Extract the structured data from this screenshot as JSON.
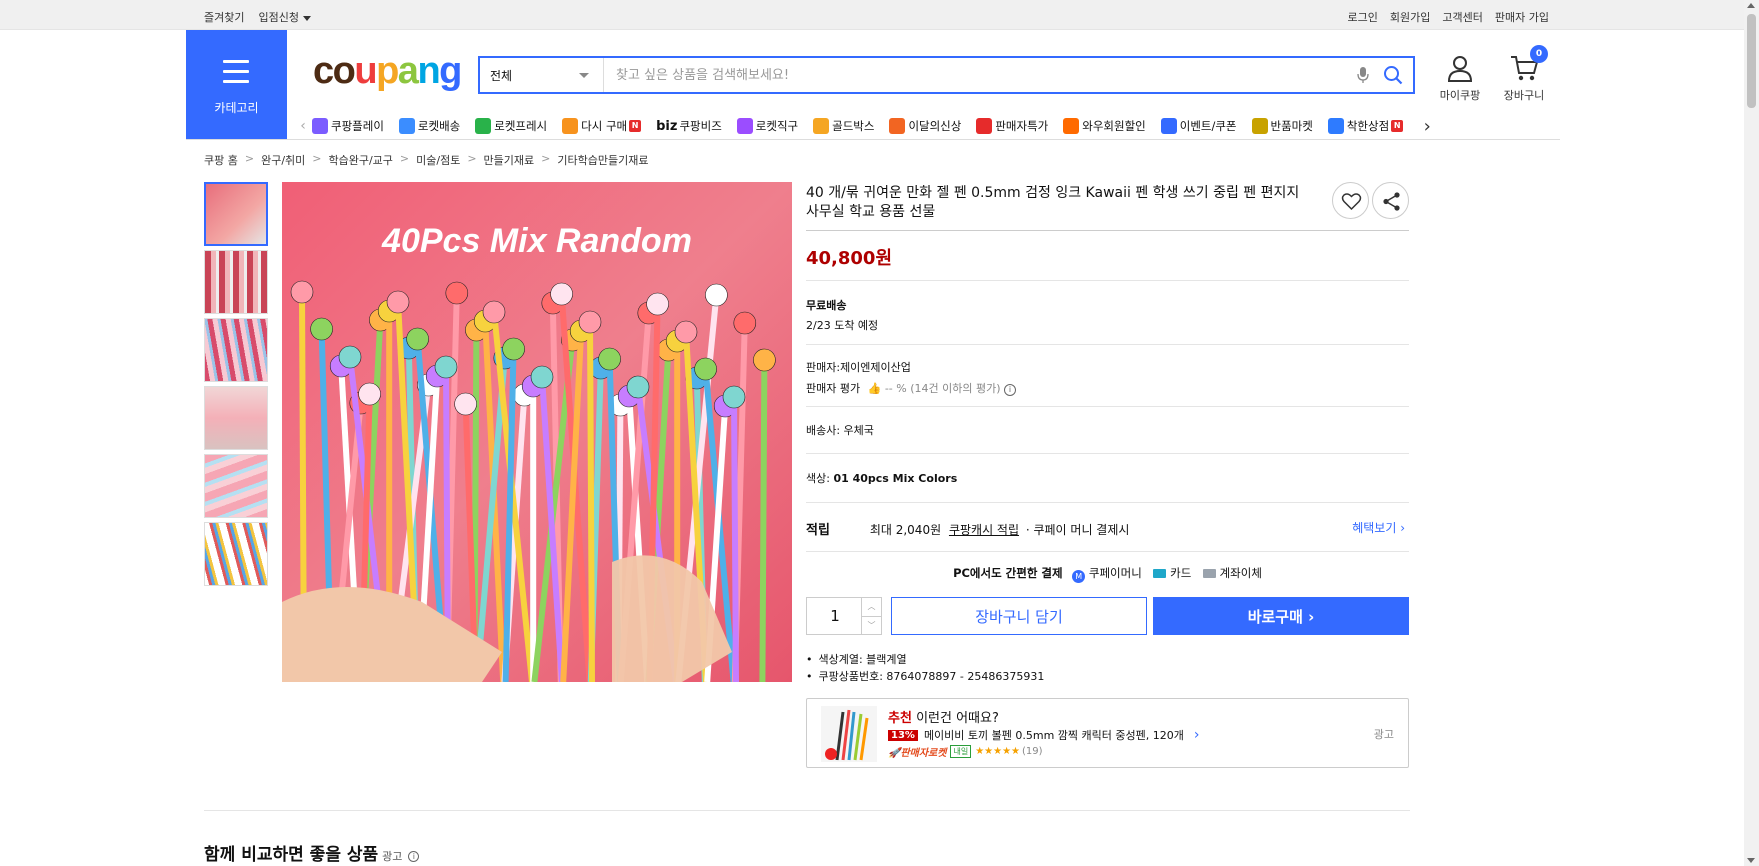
{
  "topbar": {
    "favorites": "즐겨찾기",
    "entry": "입점신청",
    "login": "로그인",
    "signup": "회원가입",
    "support": "고객센터",
    "seller_signup": "판매자 가입"
  },
  "header": {
    "category_label": "카테고리",
    "logo": [
      "c",
      "o",
      "u",
      "p",
      "a",
      "n",
      "g"
    ],
    "logo_colors": [
      "#4d2b14",
      "#4d2b14",
      "#ee3d3d",
      "#f5a623",
      "#8dc63f",
      "#00a5e3",
      "#346aff"
    ],
    "search_scope": "전체",
    "search_placeholder": "찾고 싶은 상품을 검색해보세요!",
    "my_coupang": "마이쿠팡",
    "cart_label": "장바구니",
    "cart_count": "0"
  },
  "catnav": [
    {
      "label": "쿠팡플레이",
      "color": "#7b5cff"
    },
    {
      "label": "로켓배송",
      "color": "#3b8dff"
    },
    {
      "label": "로켓프레시",
      "color": "#29b24a"
    },
    {
      "label": "다시 구매",
      "color": "#f7931e",
      "badge": "N"
    },
    {
      "label": "쿠팡비즈",
      "prefix": "biz",
      "color": "#222"
    },
    {
      "label": "로켓직구",
      "color": "#9b4dff"
    },
    {
      "label": "골드박스",
      "color": "#f5a623"
    },
    {
      "label": "이달의신상",
      "color": "#f26522"
    },
    {
      "label": "판매자특가",
      "color": "#e62b2b"
    },
    {
      "label": "와우회원할인",
      "color": "#ff6a00"
    },
    {
      "label": "이벤트/쿠폰",
      "color": "#346aff"
    },
    {
      "label": "반품마켓",
      "color": "#c8a200"
    },
    {
      "label": "착한상점",
      "color": "#2e7bff",
      "badge": "N"
    }
  ],
  "breadcrumb": [
    "쿠팡 홈",
    "완구/취미",
    "학습완구/교구",
    "미술/점토",
    "만들기재료",
    "기타학습만들기재료"
  ],
  "image_text": "40Pcs Mix Random",
  "product": {
    "title": "40 개/묶 귀여운 만화 젤 펜 0.5mm 검정 잉크 Kawaii 펜 학생 쓰기 중립 펜 편지지 사무실 학교 용품 선물",
    "price": "40,800원",
    "shipping_label": "무료배송",
    "arrival": "2/23 도착 예정",
    "seller": "판매자:제이엔제이산업",
    "seller_rating_label": "판매자 평가",
    "seller_rating_value": "-- % (14건 이하의 평가)",
    "carrier": "배송사: 우체국",
    "color_label": "색상:",
    "color_value": "01 40pcs Mix Colors",
    "reward_label": "적립",
    "reward_max": "최대 2,040원",
    "reward_link": "쿠팡캐시 적립",
    "reward_rest": "· 쿠페이 머니 결제시",
    "benefit_link": "혜택보기",
    "pay_title": "PC에서도 간편한 결제",
    "pay_methods": [
      "쿠페이머니",
      "카드",
      "계좌이체"
    ],
    "quantity": "1",
    "add_cart": "장바구니 담기",
    "buy_now": "바로구매",
    "bullets": [
      "색상계열: 블랙계열",
      "쿠팡상품번호: 8764078897 - 25486375931"
    ]
  },
  "recommend": {
    "tag": "추천",
    "title": "이런건 어때요?",
    "discount": "13%",
    "name": "메이비비 토끼 볼펜 0.5mm 깜찍 캐릭터 중성펜, 120개",
    "delivery": "판매자로켓",
    "tomorrow": "내일",
    "stars": "★★★★★",
    "reviews": "(19)",
    "ad": "광고"
  },
  "section": {
    "title": "함께 비교하면 좋을 상품",
    "ad": "광고"
  }
}
